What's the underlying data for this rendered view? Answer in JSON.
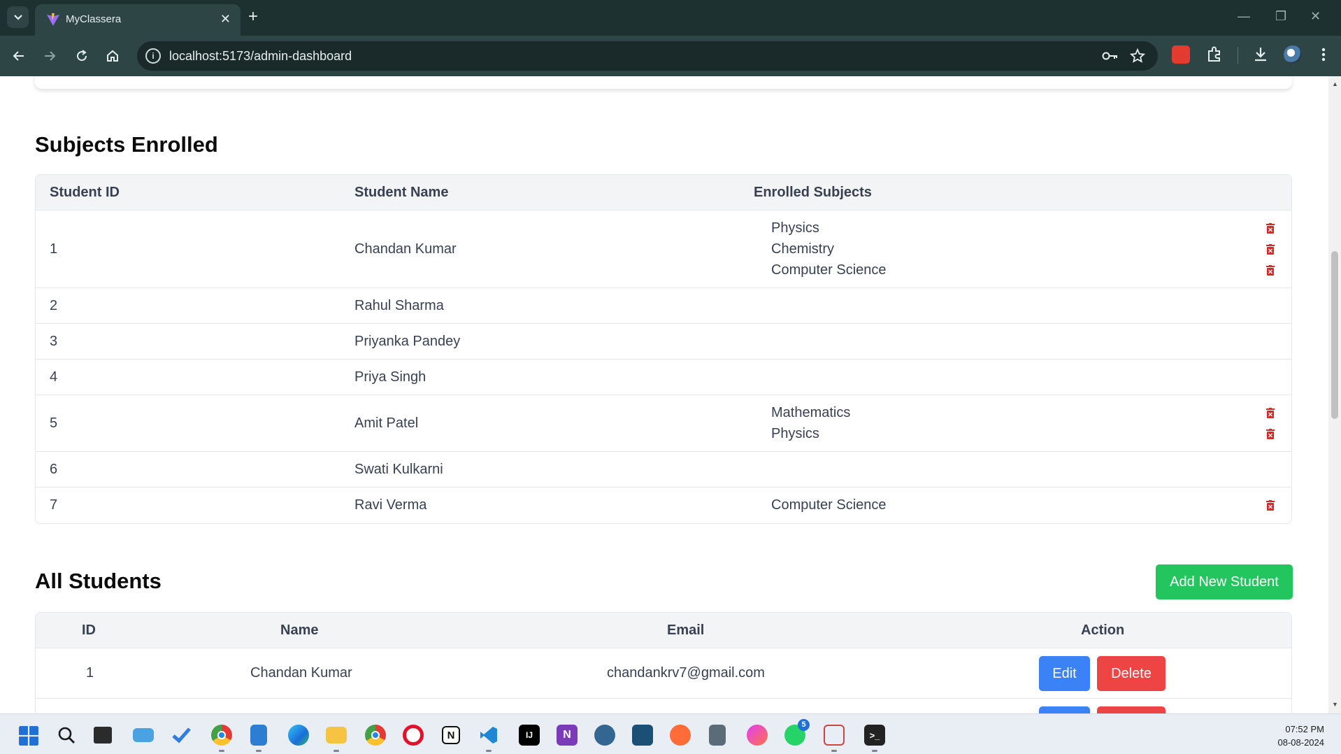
{
  "browser": {
    "tab_title": "MyClassera",
    "url": "localhost:5173/admin-dashboard"
  },
  "subjects_section": {
    "title": "Subjects Enrolled",
    "headers": [
      "Student ID",
      "Student Name",
      "Enrolled Subjects"
    ],
    "rows": [
      {
        "id": "1",
        "name": "Chandan Kumar",
        "subjects": [
          "Physics",
          "Chemistry",
          "Computer Science"
        ]
      },
      {
        "id": "2",
        "name": "Rahul Sharma",
        "subjects": []
      },
      {
        "id": "3",
        "name": "Priyanka Pandey",
        "subjects": []
      },
      {
        "id": "4",
        "name": "Priya Singh",
        "subjects": []
      },
      {
        "id": "5",
        "name": "Amit Patel",
        "subjects": [
          "Mathematics",
          "Physics"
        ]
      },
      {
        "id": "6",
        "name": "Swati Kulkarni",
        "subjects": []
      },
      {
        "id": "7",
        "name": "Ravi Verma",
        "subjects": [
          "Computer Science"
        ]
      }
    ]
  },
  "students_section": {
    "title": "All Students",
    "add_button": "Add New Student",
    "headers": [
      "ID",
      "Name",
      "Email",
      "Action"
    ],
    "rows": [
      {
        "id": "1",
        "name": "Chandan Kumar",
        "email": "chandankrv7@gmail.com"
      }
    ],
    "edit_label": "Edit",
    "delete_label": "Delete"
  },
  "taskbar": {
    "time": "07:52 PM",
    "date": "08-08-2024",
    "whatsapp_badge": "5"
  },
  "colors": {
    "accent_green": "#22c55e",
    "accent_blue": "#3b82f6",
    "accent_red": "#ef4444",
    "trash_red": "#dc2626"
  }
}
